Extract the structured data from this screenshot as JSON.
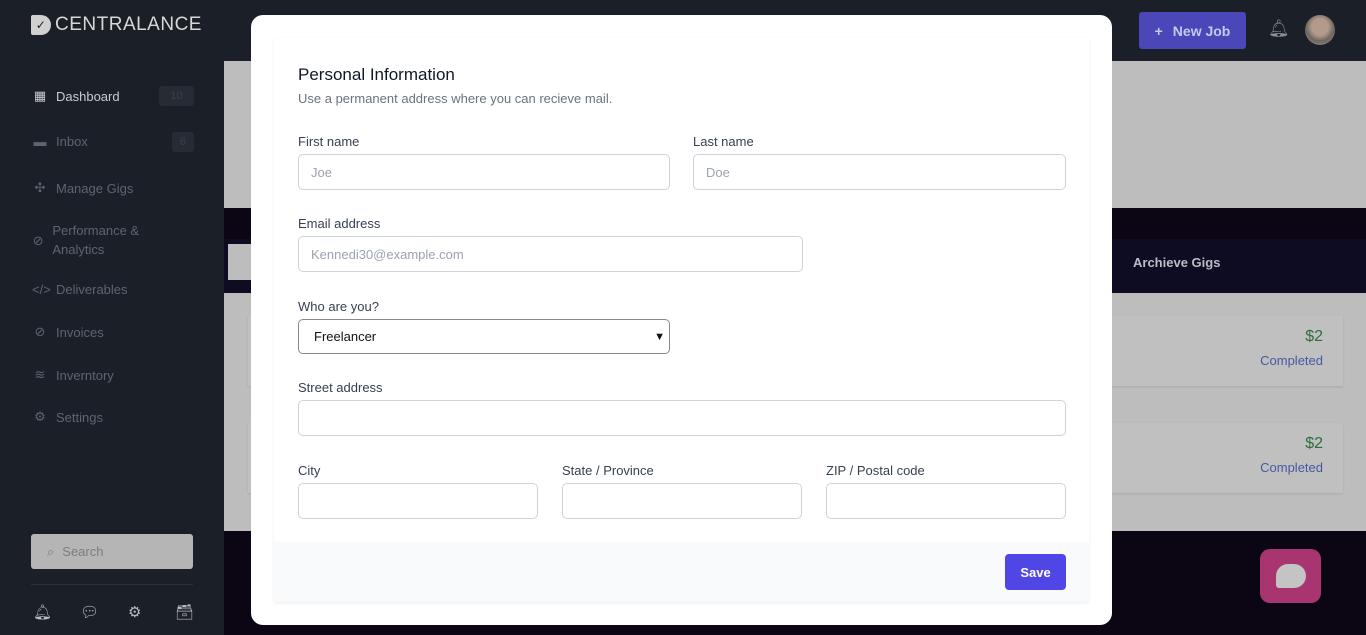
{
  "brand": "CENTRALANCE",
  "sidebar": {
    "items": [
      {
        "label": "Dashboard",
        "badge": "10",
        "icon": "grid-icon"
      },
      {
        "label": "Inbox",
        "badge": "6",
        "icon": "inbox-icon"
      },
      {
        "label": "Manage Gigs",
        "icon": "puzzle-icon"
      },
      {
        "label": "Performance & Analytics",
        "icon": "compass-icon"
      },
      {
        "label": "Deliverables",
        "icon": "code-icon"
      },
      {
        "label": "Invoices",
        "icon": "compass-icon"
      },
      {
        "label": "Inverntory",
        "icon": "layers-icon"
      },
      {
        "label": "Settings",
        "icon": "gear-icon"
      }
    ],
    "search_placeholder": "Search"
  },
  "header": {
    "new_job": "New Job"
  },
  "tabs": {
    "archieve": "Archieve Gigs"
  },
  "gigs": [
    {
      "price": "$2",
      "status": "Completed"
    },
    {
      "price": "$2",
      "status": "Completed"
    }
  ],
  "modal": {
    "title": "Personal Information",
    "subtitle": "Use a permanent address where you can recieve mail.",
    "first_name": {
      "label": "First name",
      "placeholder": "Joe"
    },
    "last_name": {
      "label": "Last name",
      "placeholder": "Doe"
    },
    "email": {
      "label": "Email address",
      "placeholder": "Kennedi30@example.com"
    },
    "role": {
      "label": "Who are you?",
      "value": "Freelancer"
    },
    "street": {
      "label": "Street address"
    },
    "city": {
      "label": "City"
    },
    "state": {
      "label": "State / Province"
    },
    "zip": {
      "label": "ZIP / Postal code"
    },
    "save": "Save"
  },
  "colors": {
    "accent": "#4f46e5",
    "chat": "#a8356f",
    "price": "#2f6e3b"
  }
}
